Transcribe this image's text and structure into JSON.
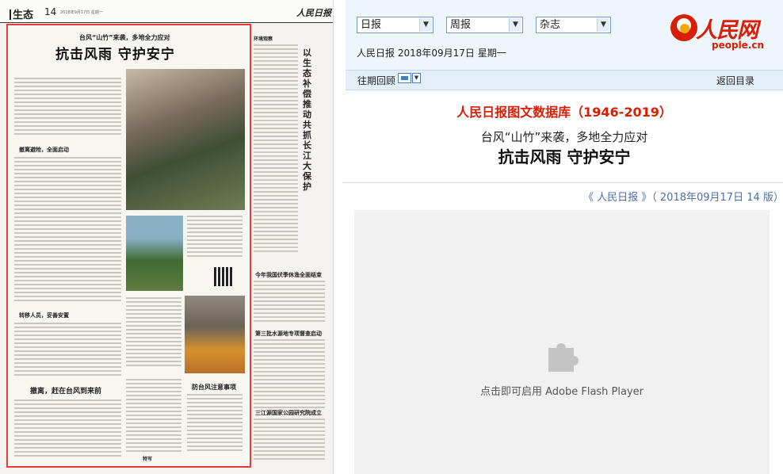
{
  "paper": {
    "section": "生态",
    "page_no": "14",
    "date_small": "2018年9月17日 星期一",
    "masthead": "人民日报",
    "kicker": "台风“山竹”来袭，多地全力应对",
    "headline": "抗击风雨 守护安宁",
    "right_vertical_title": "以生态补偿推动共抓长江大保护",
    "sub1": "撤离避险，全面启动",
    "sub2": "转移人员，妥善安置",
    "sub3": "撤离，赶在台风到来前",
    "sub4": "防台风注意事项",
    "right_head1": "今年我国伏季休渔全面结束",
    "right_head2": "第三批水源地专项督查启动",
    "right_head3": "三江源国家公园研究院成立",
    "tag_left": "环境观察",
    "tag_bottom": "特写"
  },
  "toolbar": {
    "selects": [
      {
        "label": "日报"
      },
      {
        "label": "周报"
      },
      {
        "label": "杂志"
      }
    ],
    "date_line": "人民日报 2018年09月17日 星期一"
  },
  "brand": {
    "name_cn": "人民网",
    "name_en": "people.cn"
  },
  "nav": {
    "past_issues": "往期回顾",
    "back_to_index": "返回目录"
  },
  "article": {
    "db_title": "人民日报图文数据库（1946-2019）",
    "subhead": "台风“山竹”来袭，多地全力应对",
    "headline": "抗击风雨 守护安宁",
    "source": "《 人民日报 》（ 2018年09月17日   14 版）"
  },
  "flash": {
    "message": "点击即可启用 Adobe Flash Player",
    "icon": "plugin-puzzle-icon"
  },
  "colors": {
    "accent_red": "#d81e06",
    "frame_red": "#e53b3b",
    "link_blue": "#4b6fa8",
    "toolbar_bg": "#eef6fc"
  }
}
